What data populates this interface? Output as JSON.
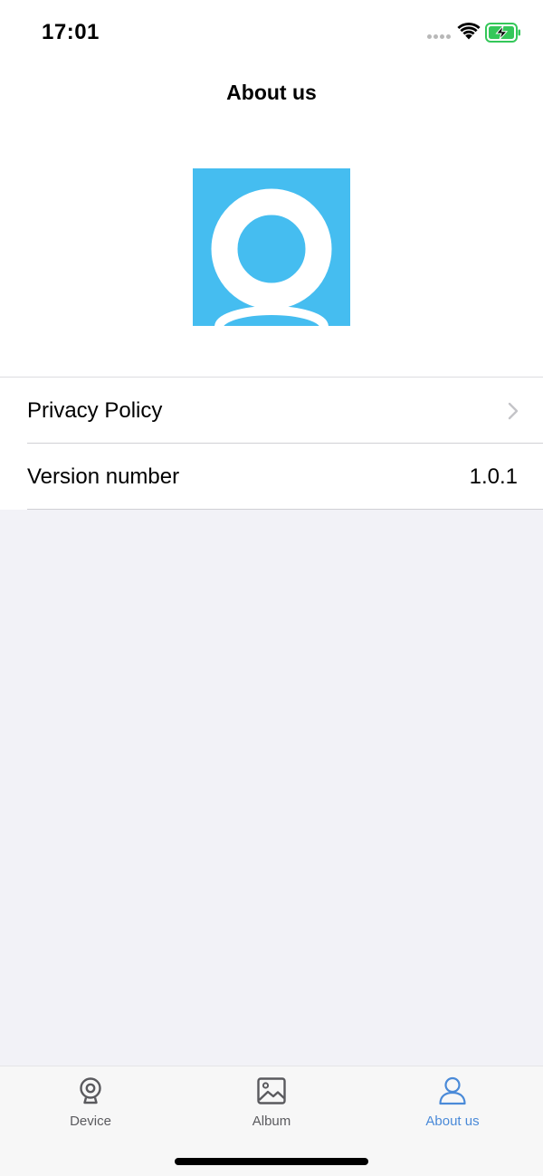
{
  "status_bar": {
    "time": "17:01",
    "icons": [
      "signal-dots",
      "wifi-icon",
      "battery-charging-icon"
    ],
    "battery_color": "#34c759"
  },
  "header": {
    "title": "About us",
    "logo": {
      "icon": "webcam-logo",
      "background_color": "#45bdf0"
    }
  },
  "list": {
    "items": [
      {
        "label": "Privacy Policy",
        "accessory": "chevron-right-icon"
      },
      {
        "label": "Version number",
        "value": "1.0.1"
      }
    ]
  },
  "tab_bar": {
    "active_color": "#4a8ad8",
    "inactive_color": "#5a5a5e",
    "tabs": [
      {
        "label": "Device",
        "icon": "webcam-icon",
        "active": false
      },
      {
        "label": "Album",
        "icon": "image-icon",
        "active": false
      },
      {
        "label": "About us",
        "icon": "person-icon",
        "active": true
      }
    ]
  }
}
